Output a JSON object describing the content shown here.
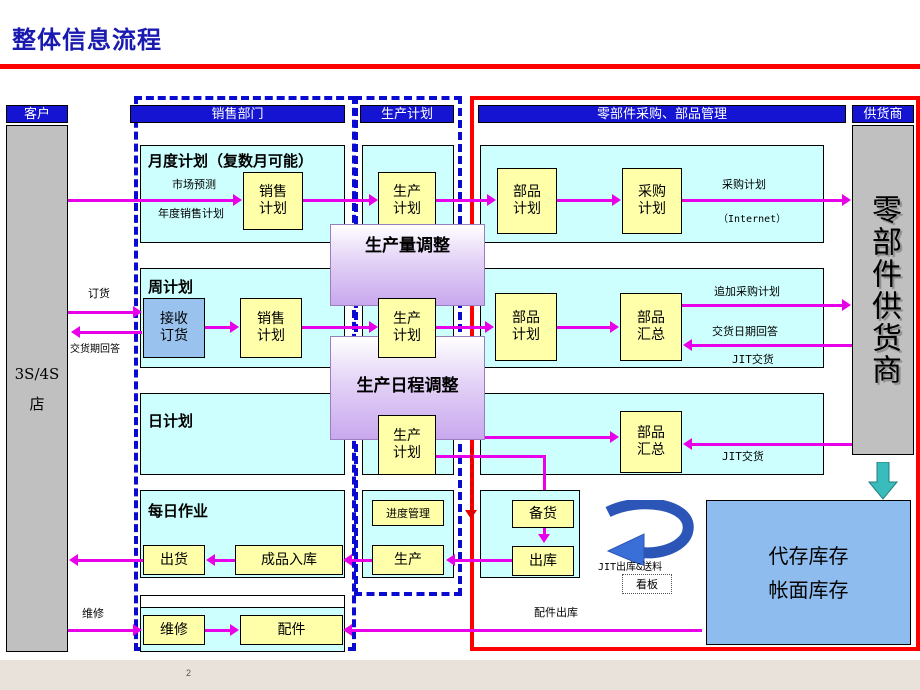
{
  "page": {
    "title": "整体信息流程",
    "page_number": "2",
    "accent_red": "#ff0000",
    "header_blue": "#1414d2",
    "lane_cyan": "#ccfffd",
    "box_yellow": "#ffffaa",
    "box_blue": "#99c2ee",
    "arrow_magenta": "#e800e8",
    "grey": "#c0c0c0",
    "stock_blue": "#8fbcee"
  },
  "columns": {
    "customer": "客户",
    "sales_dept": "销售部门",
    "production_plan": "生产计划",
    "parts_purchase": "零部件采购、部品管理",
    "supplier": "供货商"
  },
  "left_party": {
    "line1": "3S/4S",
    "line2": "店"
  },
  "right_party": {
    "label": "零部件供货商"
  },
  "rows": [
    {
      "title": "月度计划（复数月可能）"
    },
    {
      "title": "周计划"
    },
    {
      "title": "日计划"
    },
    {
      "title": "每日作业"
    }
  ],
  "boxes": {
    "sales_plan_month": "销售\n计划",
    "prod_plan_month": "生产\n计划",
    "parts_plan_month": "部品\n计划",
    "purchase_plan_month": "采购\n计划",
    "receive_order": "接收\n订货",
    "sales_plan_week": "销售\n计划",
    "prod_plan_week": "生产\n计划",
    "parts_plan_week": "部品\n计划",
    "parts_summary_week": "部品\n汇总",
    "prod_plan_day": "生产\n计划",
    "parts_summary_day": "部品\n汇总",
    "progress_mgmt": "进度管理",
    "production": "生产",
    "finished_goods": "成品入库",
    "shipment": "出货",
    "stock_prep": "备货",
    "outbound": "出库",
    "repair": "维修",
    "parts_item": "配件"
  },
  "overlays": {
    "volume_adjust": "生产量调整",
    "schedule_adjust": "生产日程调整"
  },
  "flow_labels": {
    "market_forecast": "市场预测",
    "annual_sales_plan": "年度销售计划",
    "purchase_plan": "采购计划",
    "internet": "（Internet）",
    "order": "订货",
    "delivery_reply": "交货期回答",
    "extra_purchase_plan": "追加采购计划",
    "delivery_date_reply": "交货日期回答",
    "jit_delivery_week": "JIT交货",
    "jit_delivery_day": "JIT交货",
    "jit_out_and_feed": "JIT出库&送料",
    "kanban": "看板",
    "parts_outbound": "配件出库",
    "repair_label": "维修"
  },
  "stock_panel": {
    "line1": "代存库存",
    "line2": "帐面库存"
  }
}
